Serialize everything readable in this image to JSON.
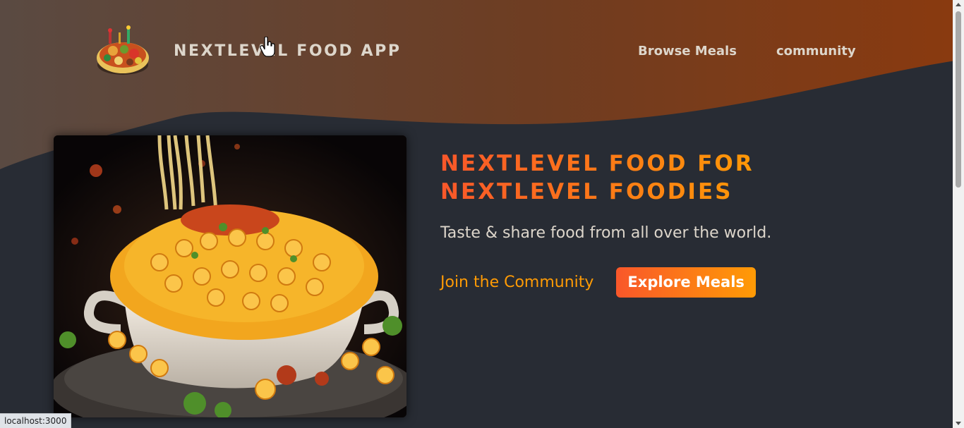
{
  "header": {
    "logo_icon": "food-plate-logo",
    "logo_text": "NextLevel Food App",
    "nav": [
      {
        "label": "Browse Meals"
      },
      {
        "label": "community"
      }
    ]
  },
  "hero": {
    "image_icon": "mac-and-cheese-photo",
    "title": "NextLevel Food for NextLevel Foodies",
    "subtitle": "Taste & share food from all over the world.",
    "community_link": "Join the Community",
    "explore_button": "Explore Meals"
  },
  "status_bar": {
    "url": "localhost:3000"
  },
  "colors": {
    "background": "#282c34",
    "header_gradient_start": "#5a4a42",
    "header_gradient_end": "#8a3a0f",
    "accent_start": "#f9572a",
    "accent_end": "#ff9b05",
    "nav_text": "#ddd6cb"
  }
}
